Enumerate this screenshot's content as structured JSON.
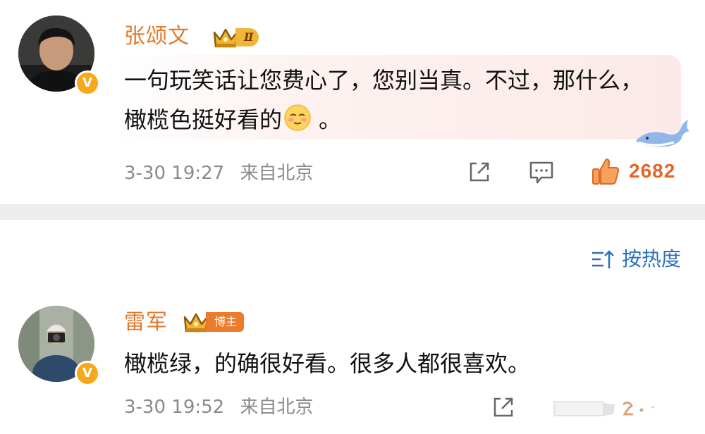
{
  "comments": [
    {
      "username": "张颂文",
      "level_badge": "Ⅱ",
      "text": "一句玩笑话让您费心了，您别当真。不过，那什么，橄榄色挺好看的",
      "text_end": "。",
      "emoji": "blush-emoji",
      "date": "3-30 19:27",
      "location": "来自北京",
      "likes": "2682",
      "icons": [
        "share-icon",
        "reply-icon",
        "like-icon"
      ]
    },
    {
      "username": "雷军",
      "role_badge": "博主",
      "text": "橄榄绿，的确很好看。很多人都很喜欢。",
      "date": "3-30 19:52",
      "location": "来自北京",
      "icons": [
        "share-icon"
      ]
    }
  ],
  "verified_badge": "V",
  "sort": {
    "label": "按热度",
    "icon": "sort-hot-icon"
  },
  "colors": {
    "username": "#e07a2d",
    "meta": "#8a8a8a",
    "likes": "#e0662a",
    "sort_link": "#2a6fbf",
    "divider": "#ededed"
  }
}
